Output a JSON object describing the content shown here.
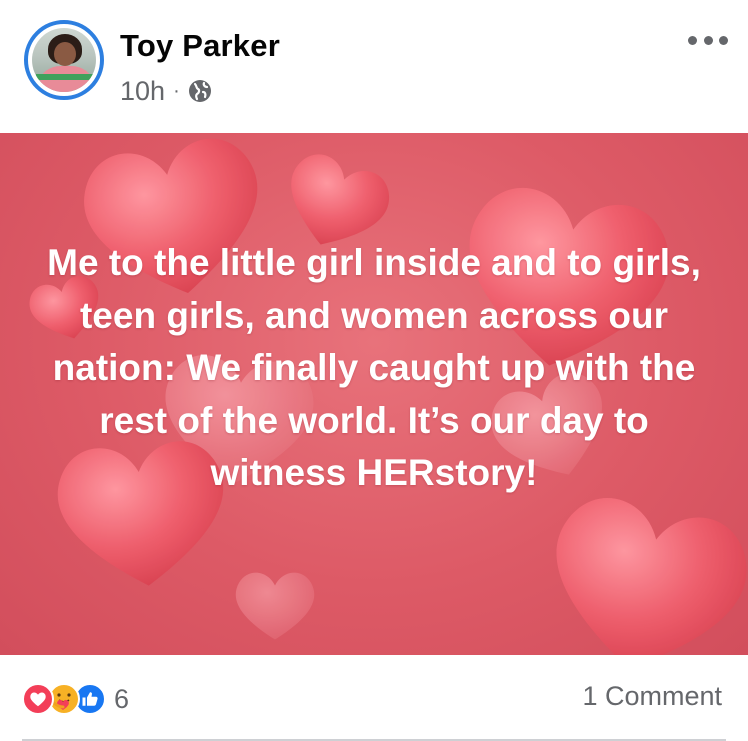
{
  "post": {
    "author": "Toy Parker",
    "time": "10h",
    "separator": "·",
    "audience_icon": "globe-icon",
    "menu_icon": "more-horizontal-icon",
    "image_text": "Me to the little girl inside and to girls, teen girls, and women across our nation: We finally caught up with the rest of the world. It’s our day to witness HERstory!",
    "image_background": "#dd5a66"
  },
  "engagement": {
    "reaction_icons": [
      "love-icon",
      "care-icon",
      "like-icon"
    ],
    "reaction_count": "6",
    "comment_count": "1 Comment"
  },
  "colors": {
    "avatar_ring": "#2d7fe0",
    "meta_text": "#65676b",
    "love": "#f33e58",
    "care": "#f7b125",
    "like": "#1877f2"
  }
}
